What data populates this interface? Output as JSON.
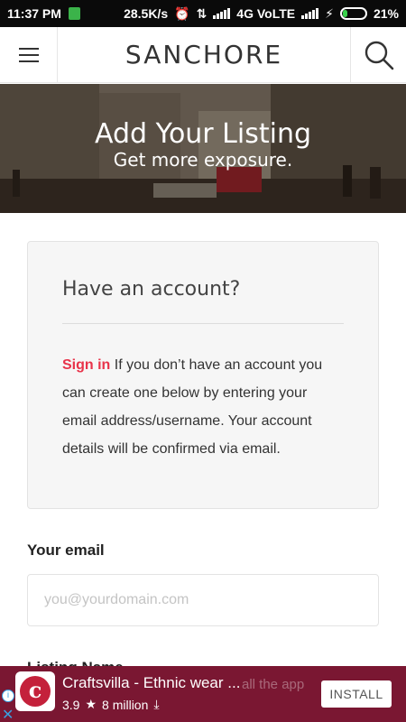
{
  "status_bar": {
    "time": "11:37 PM",
    "net_speed": "28.5K/s",
    "network": "4G VoLTE",
    "battery": "21%",
    "battery_level": 0.21
  },
  "header": {
    "title": "SANCHORE"
  },
  "hero": {
    "title": "Add Your Listing",
    "subtitle": "Get more exposure."
  },
  "account_box": {
    "title": "Have an account?",
    "sign_in_label": "Sign in",
    "body": " If you don’t have an account you can create one below by entering your email address/username. Your account details will be confirmed via email."
  },
  "form": {
    "email_label": "Your email",
    "email_placeholder": "you@yourdomain.com",
    "next_label_partial": "Listing Name"
  },
  "ad": {
    "app_name": "Craftsvilla - Ethnic wear ...",
    "ghost_text": "all the app",
    "rating": "3.9",
    "downloads": "8 million",
    "install_label": "INSTALL",
    "brand_color": "#7a1732"
  },
  "colors": {
    "accent": "#e8334a",
    "text": "#333333"
  }
}
